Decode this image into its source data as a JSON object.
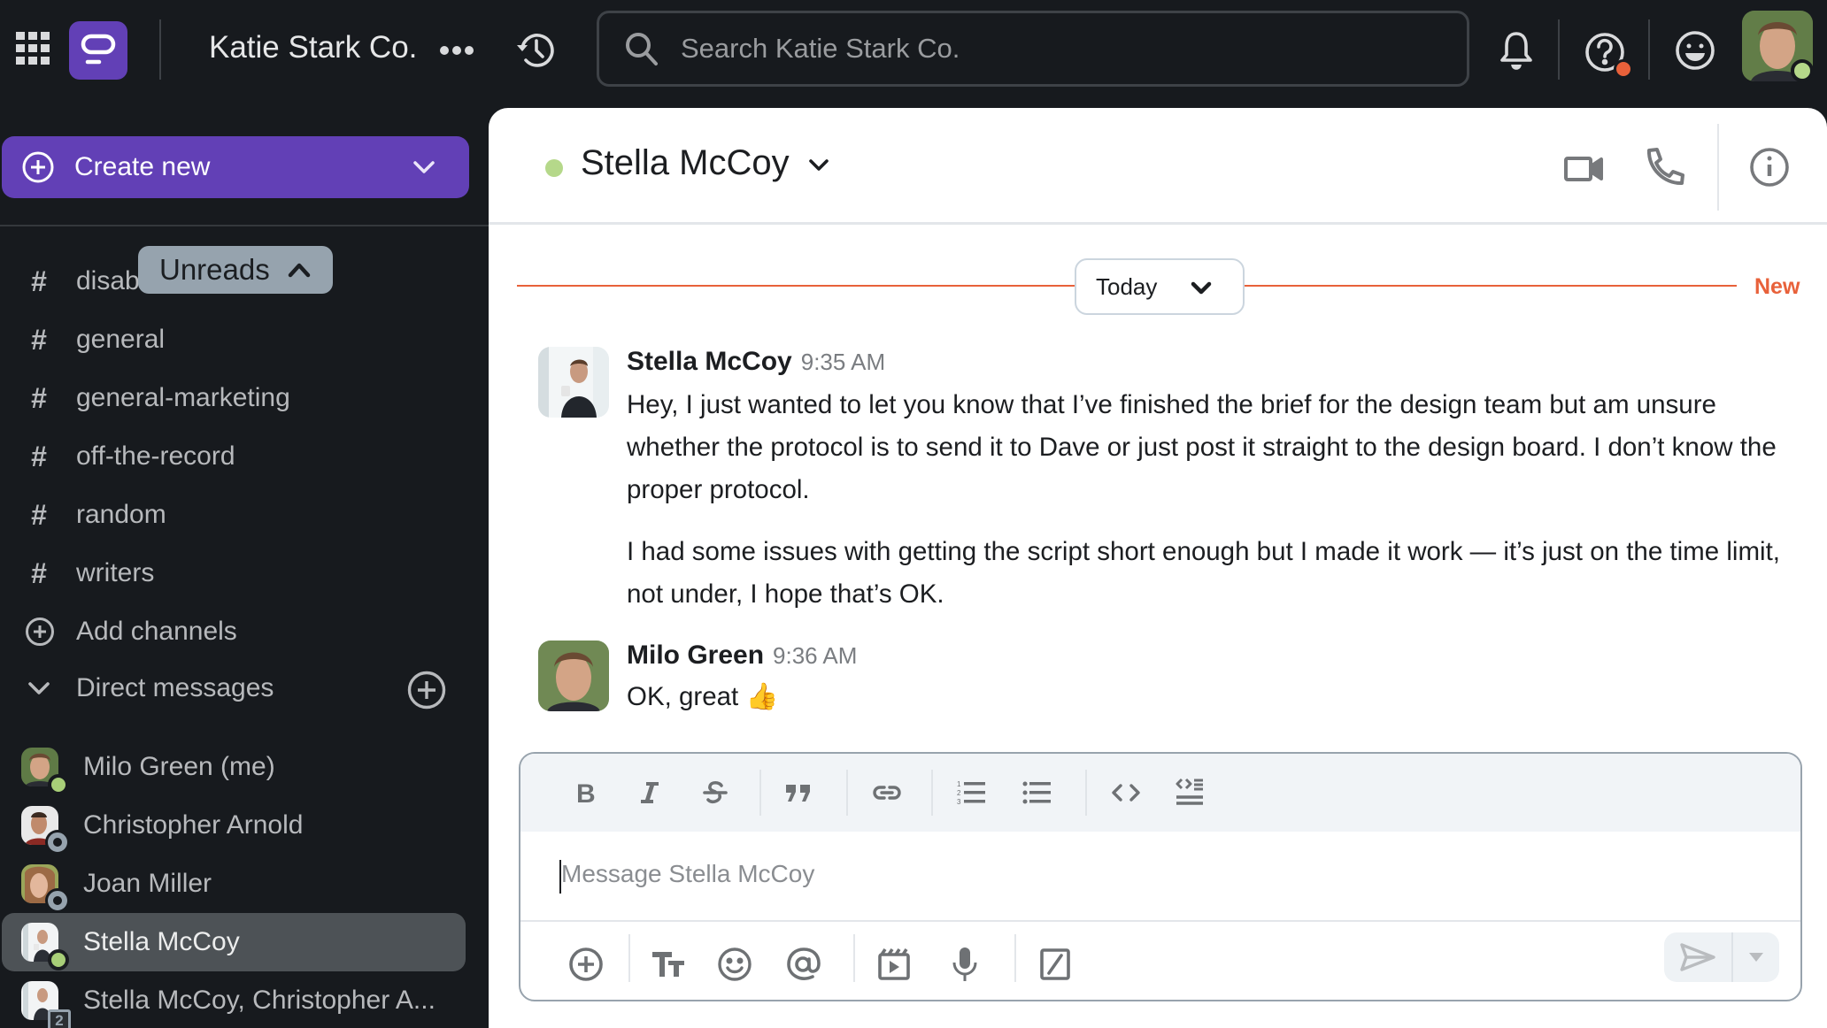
{
  "topbar": {
    "workspace_name": "Katie Stark Co.",
    "search_placeholder": "Search Katie Stark Co.",
    "icons": [
      "app-grid-icon",
      "logo-icon",
      "more-icon",
      "history-icon",
      "search-icon",
      "bell-icon",
      "help-icon",
      "emoji-icon",
      "user-avatar"
    ],
    "help_badge_color": "#e8613a",
    "user_status": "online"
  },
  "sidebar": {
    "create_new_label": "Create new",
    "unreads_label": "Unreads",
    "channels": [
      {
        "name": "disabil"
      },
      {
        "name": "general"
      },
      {
        "name": "general-marketing"
      },
      {
        "name": "off-the-record"
      },
      {
        "name": "random"
      },
      {
        "name": "writers"
      }
    ],
    "add_channels_label": "Add channels",
    "direct_messages_label": "Direct messages",
    "direct_messages": [
      {
        "name": "Milo Green (me)",
        "status": "online",
        "active": false
      },
      {
        "name": "Christopher Arnold",
        "status": "away",
        "active": false
      },
      {
        "name": "Joan Miller",
        "status": "away",
        "active": false
      },
      {
        "name": "Stella McCoy",
        "status": "online",
        "active": true
      },
      {
        "name": "Stella McCoy, Christopher A...",
        "status": "group",
        "member_count": "2",
        "active": false
      }
    ]
  },
  "channel_header": {
    "title": "Stella McCoy",
    "status": "online"
  },
  "divider": {
    "date_label": "Today",
    "new_label": "New"
  },
  "messages": [
    {
      "author": "Stella McCoy",
      "time": "9:35 AM",
      "paragraphs": [
        "Hey, I just wanted to let you know that I’ve finished the brief for the design team but am unsure whether the protocol is to send it to Dave or just post it straight to the design board. I don’t know the proper protocol.",
        "I had some issues with getting the script short enough but I made it work — it’s just on the time limit, not under, I hope that’s OK."
      ]
    },
    {
      "author": "Milo Green",
      "time": "9:36 AM",
      "paragraphs": [
        "OK, great 👍"
      ]
    }
  ],
  "composer": {
    "placeholder": "Message Stella McCoy",
    "format_tools": [
      "bold",
      "italic",
      "strikethrough",
      "quote",
      "link",
      "ordered-list",
      "bulleted-list",
      "code",
      "code-block"
    ],
    "action_tools": [
      "attach",
      "formatting",
      "emoji",
      "mention",
      "gif",
      "voice",
      "slash-command"
    ]
  },
  "colors": {
    "brand": "#6240b6",
    "sidebar_bg": "#171a1e",
    "new_accent": "#e8613a",
    "online": "#b5d88a"
  }
}
